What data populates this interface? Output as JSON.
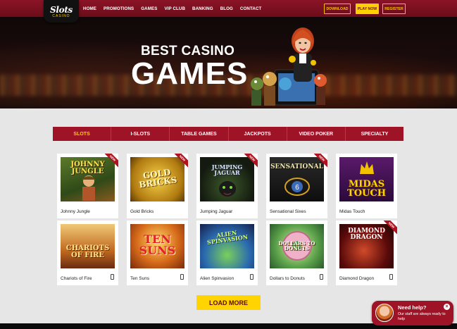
{
  "logo": {
    "word": "Slots",
    "sub": "CASINO"
  },
  "nav": [
    "HOME",
    "PROMOTIONS",
    "GAMES",
    "VIP CLUB",
    "BANKING",
    "BLOG",
    "CONTACT"
  ],
  "header_buttons": {
    "download": "DOWNLOAD",
    "play_now": "PLAY NOW",
    "register": "REGISTER"
  },
  "hero": {
    "subtitle": "BEST CASINO",
    "title": "GAMES"
  },
  "tabs": [
    "SLOTS",
    "I-SLOTS",
    "TABLE GAMES",
    "JACKPOTS",
    "VIDEO POKER",
    "SPECIALTY"
  ],
  "active_tab": "SLOTS",
  "ribbon_label": "NEW",
  "games": [
    {
      "name": "Johnny Jungle",
      "new": true,
      "mobile": false,
      "art": "JOHNNY JUNGLE"
    },
    {
      "name": "Gold Bricks",
      "new": true,
      "mobile": false,
      "art": "GOLD BRICKS"
    },
    {
      "name": "Jumping Jaguar",
      "new": true,
      "mobile": false,
      "art": "JUMPING JAGUAR"
    },
    {
      "name": "Sensational Sixes",
      "new": true,
      "mobile": false,
      "art": "SENSATIONAL"
    },
    {
      "name": "Midas Touch",
      "new": false,
      "mobile": false,
      "art": "MIDAS TOUCH"
    },
    {
      "name": "Chariots of Fire",
      "new": false,
      "mobile": true,
      "art": "CHARIOTS OF FIRE"
    },
    {
      "name": "Ten Suns",
      "new": false,
      "mobile": true,
      "art": "TEN SUNS"
    },
    {
      "name": "Alien Spinvasion",
      "new": false,
      "mobile": true,
      "art": "ALIEN SPINVASION"
    },
    {
      "name": "Dollars to Donuts",
      "new": false,
      "mobile": true,
      "art": "DOLLARS TO DONUTS"
    },
    {
      "name": "Diamond Dragon",
      "new": true,
      "mobile": true,
      "art": "DIAMOND DRAGON"
    }
  ],
  "load_more": "LOAD MORE",
  "help": {
    "title": "Need help?",
    "text": "Our staff are always ready to help",
    "close": "×"
  },
  "colors": {
    "brand_red": "#9e1426",
    "accent_yellow": "#ffd400"
  }
}
